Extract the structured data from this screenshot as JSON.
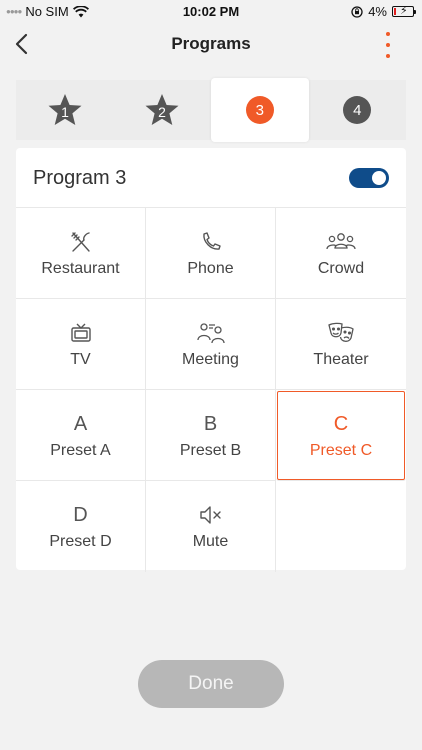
{
  "status": {
    "carrier": "No SIM",
    "time": "10:02 PM",
    "battery": "4%"
  },
  "nav": {
    "title": "Programs"
  },
  "tabs": [
    {
      "label": "1",
      "type": "star"
    },
    {
      "label": "2",
      "type": "star"
    },
    {
      "label": "3",
      "type": "circle",
      "color": "#f05a28"
    },
    {
      "label": "4",
      "type": "circle",
      "color": "#555555"
    }
  ],
  "program": {
    "name": "Program 3",
    "enabled": true
  },
  "grid": {
    "restaurant": "Restaurant",
    "phone": "Phone",
    "crowd": "Crowd",
    "tv": "TV",
    "meeting": "Meeting",
    "theater": "Theater",
    "preset_a_letter": "A",
    "preset_a": "Preset A",
    "preset_b_letter": "B",
    "preset_b": "Preset B",
    "preset_c_letter": "C",
    "preset_c": "Preset C",
    "preset_d_letter": "D",
    "preset_d": "Preset D",
    "mute": "Mute"
  },
  "done_label": "Done",
  "colors": {
    "accent": "#f05a28",
    "toggle": "#0f4c8a",
    "done_disabled": "#b7b7b7"
  }
}
